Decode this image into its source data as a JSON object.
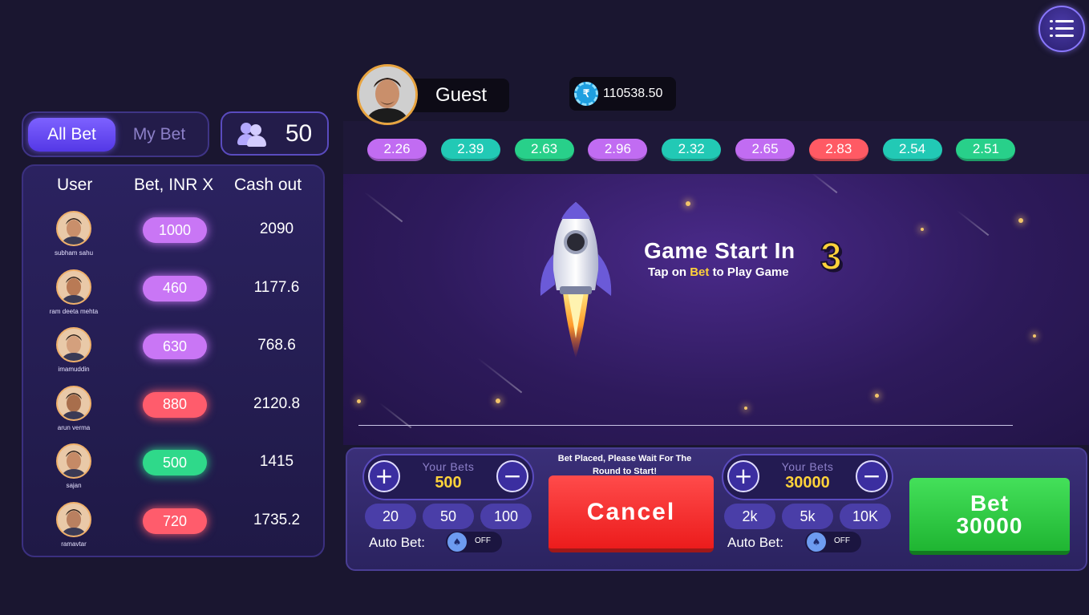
{
  "header": {
    "user_name": "Guest",
    "balance": "110538.50",
    "currency_icon": "rupee-coin-icon"
  },
  "left_panel": {
    "tabs": [
      {
        "label": "All Bet",
        "active": true
      },
      {
        "label": "My Bet",
        "active": false
      }
    ],
    "players_count": "50",
    "columns": [
      "User",
      "Bet, INR X",
      "Cash out"
    ],
    "rows": [
      {
        "name": "subham sahu",
        "bet": "1000",
        "cashout": "2090",
        "bet_color": "#c976f5"
      },
      {
        "name": "ram deeta mehta",
        "bet": "460",
        "cashout": "1177.6",
        "bet_color": "#c976f5"
      },
      {
        "name": "imamuddin",
        "bet": "630",
        "cashout": "768.6",
        "bet_color": "#c976f5"
      },
      {
        "name": "arun verma",
        "bet": "880",
        "cashout": "2120.8",
        "bet_color": "#ff5c6c"
      },
      {
        "name": "sajan",
        "bet": "500",
        "cashout": "1415",
        "bet_color": "#2fd98a"
      },
      {
        "name": "ramavtar",
        "bet": "720",
        "cashout": "1735.2",
        "bet_color": "#ff5c6c"
      }
    ]
  },
  "multipliers": [
    {
      "value": "2.26",
      "color": "#c16cf2"
    },
    {
      "value": "2.39",
      "color": "#22c9b5"
    },
    {
      "value": "2.63",
      "color": "#28d08a"
    },
    {
      "value": "2.96",
      "color": "#c16cf2"
    },
    {
      "value": "2.32",
      "color": "#22c9b5"
    },
    {
      "value": "2.65",
      "color": "#c16cf2"
    },
    {
      "value": "2.83",
      "color": "#ff5a64"
    },
    {
      "value": "2.54",
      "color": "#22c9b5"
    },
    {
      "value": "2.51",
      "color": "#28d08a"
    }
  ],
  "game": {
    "title": "Game Start In",
    "countdown": "3",
    "subtitle_pre": "Tap on",
    "subtitle_highlight": "Bet",
    "subtitle_post": "to Play Game"
  },
  "controls": {
    "left": {
      "label": "Your Bets",
      "value": "500",
      "chips": [
        "20",
        "50",
        "100"
      ],
      "auto_bet_label": "Auto Bet:",
      "toggle_state": "OFF"
    },
    "status_message": "Bet Placed, Please Wait For The Round to Start!",
    "cancel_label": "Cancel",
    "right": {
      "label": "Your Bets",
      "value": "30000",
      "chips": [
        "2k",
        "5k",
        "10K"
      ],
      "auto_bet_label": "Auto Bet:",
      "toggle_state": "OFF"
    },
    "bet_button_line1": "Bet",
    "bet_button_line2": "30000"
  },
  "colors": {
    "accent": "#7d62ff",
    "cancel": "#f02424",
    "bet": "#2ec843",
    "highlight": "#ffd23a"
  }
}
